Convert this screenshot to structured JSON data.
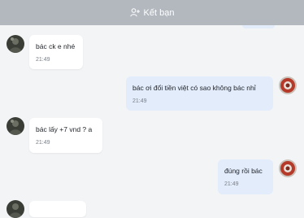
{
  "header": {
    "title": "Kết bạn",
    "icon": "add-friend-icon"
  },
  "messages": [
    {
      "direction": "in",
      "text": "bác ck e nhé",
      "time": "21:49"
    },
    {
      "direction": "out",
      "text": "bác ơi đổi tiền việt có sao không bác nhỉ",
      "time": "21:49"
    },
    {
      "direction": "in",
      "text": "bác lấy +7 vnd ? a",
      "time": "21:49"
    },
    {
      "direction": "out",
      "text": "đúng rồi bác",
      "time": "21:49"
    }
  ],
  "colors": {
    "header": "#b3b8bf",
    "incoming": "#ffffff",
    "outgoing": "#e3ecfb",
    "background": "#f3f4f6"
  }
}
